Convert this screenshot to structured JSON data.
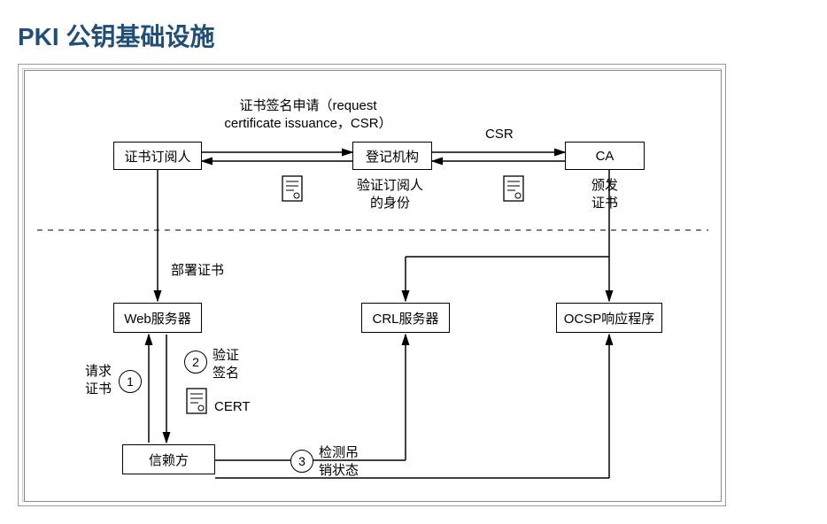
{
  "title": "PKI 公钥基础设施",
  "nodes": {
    "subscriber": "证书订阅人",
    "ra": "登记机构",
    "ca": "CA",
    "web": "Web服务器",
    "crl": "CRL服务器",
    "ocsp": "OCSP响应程序",
    "rp": "信赖方"
  },
  "labels": {
    "csrRequestLine1": "证书签名申请（request",
    "csrRequestLine2": "certificate issuance，CSR）",
    "csr": "CSR",
    "verifySubLine1": "验证订阅人",
    "verifySubLine2": "的身份",
    "issueCertLine1": "颁发",
    "issueCertLine2": "证书",
    "deployCert": "部署证书",
    "reqCertLine1": "请求",
    "reqCertLine2": "证书",
    "verifySigLine1": "验证",
    "verifySigLine2": "签名",
    "certText": "CERT",
    "checkRevLine1": "检测吊",
    "checkRevLine2": "销状态"
  },
  "steps": {
    "one": "1",
    "two": "2",
    "three": "3"
  }
}
